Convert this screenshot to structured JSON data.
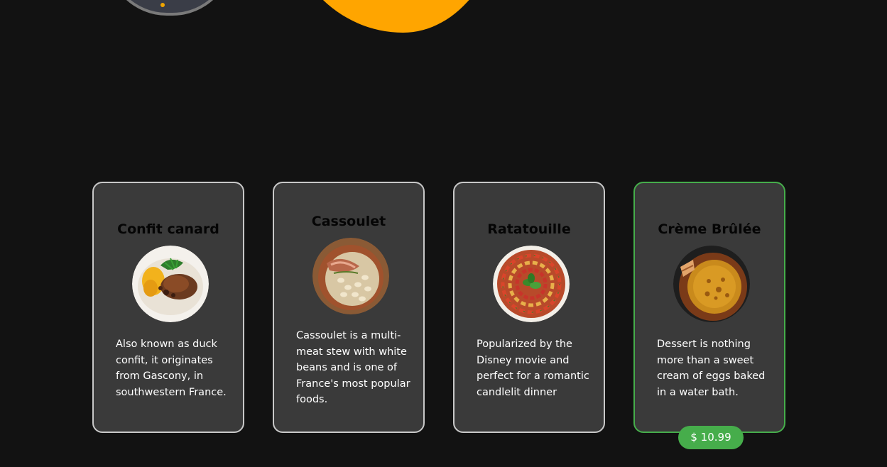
{
  "colors": {
    "background": "#121212",
    "card": "#3a3a3a",
    "card_border": "#c8c8c8",
    "accent_green": "#46ad4b",
    "accent_orange": "#ffa500"
  },
  "cards": [
    {
      "title": "Confit canard",
      "image": "confit-canard-dish-icon",
      "description": "Also known as duck confit, it originates from Gascony, in southwestern France."
    },
    {
      "title": "Cassoulet",
      "image": "cassoulet-dish-icon",
      "description": "Cassoulet is a multi-meat stew with white beans and is one of France's most popular foods."
    },
    {
      "title": "Ratatouille",
      "image": "ratatouille-dish-icon",
      "description": "Popularized by the Disney movie and perfect for a romantic candlelit dinner"
    },
    {
      "title": "Crème Brûlée",
      "image": "creme-brulee-dish-icon",
      "description": "Dessert is nothing more than a sweet cream of eggs baked in a water bath.",
      "selected": true
    }
  ],
  "price_badge": "$ 10.99"
}
